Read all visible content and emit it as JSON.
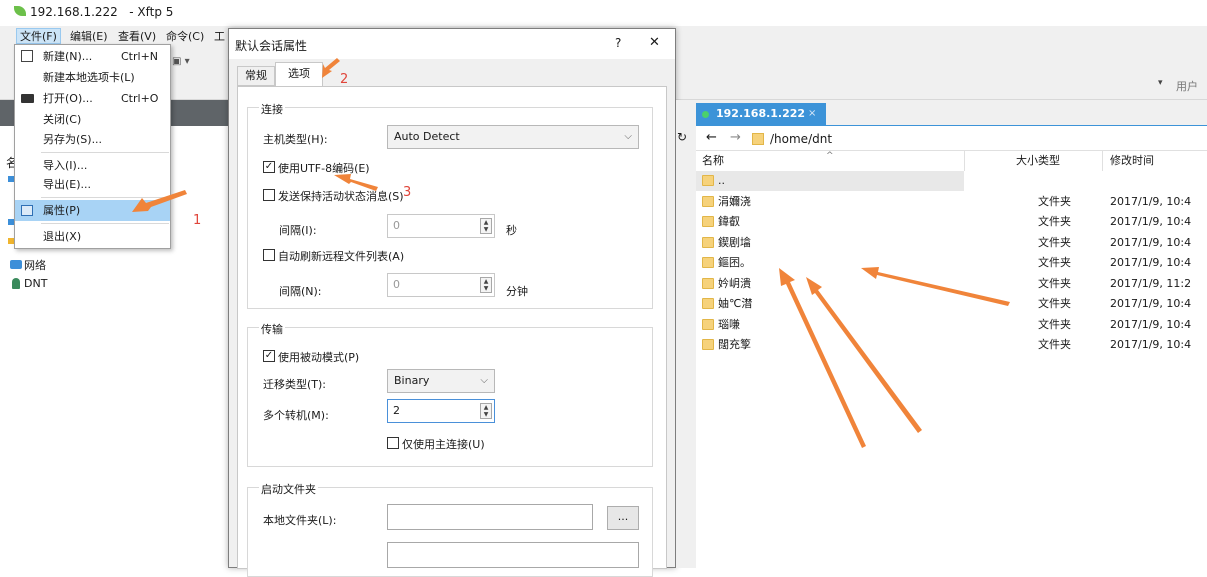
{
  "window": {
    "title": "192.168.1.222   - Xftp 5"
  },
  "menubar": {
    "items": [
      "文件(F)",
      "编辑(E)",
      "查看(V)",
      "命令(C)",
      "工"
    ]
  },
  "file_menu": {
    "items": [
      {
        "label": "新建(N)...",
        "shortcut": "Ctrl+N",
        "icon": "new-session-icon"
      },
      {
        "label": "新建本地选项卡(L)",
        "shortcut": ""
      },
      {
        "label": "打开(O)...",
        "shortcut": "Ctrl+O",
        "icon": "open-folder-icon"
      },
      {
        "label": "关闭(C)",
        "shortcut": ""
      },
      {
        "label": "另存为(S)...",
        "shortcut": ""
      },
      {
        "label": "导入(I)...",
        "shortcut": ""
      },
      {
        "label": "导出(E)...",
        "shortcut": ""
      },
      {
        "label": "属性(P)",
        "shortcut": "",
        "icon": "properties-icon",
        "highlighted": true
      },
      {
        "label": "退出(X)",
        "shortcut": ""
      }
    ]
  },
  "left_pane": {
    "items": [
      "网络",
      "DNT"
    ],
    "header_partial": "名"
  },
  "dialog": {
    "title": "默认会话属性",
    "help": "?",
    "close": "✕",
    "tabs": [
      "常规",
      "选项"
    ],
    "active_tab": "选项",
    "sections": {
      "connection": {
        "title": "连接",
        "host_type_label": "主机类型(H):",
        "host_type_value": "Auto Detect",
        "utf8_label": "使用UTF-8编码(E)",
        "utf8_checked": true,
        "keepalive_label": "发送保持活动状态消息(S)",
        "keepalive_checked": false,
        "interval_label": "间隔(I):",
        "interval_value": "0",
        "interval_unit": "秒",
        "autorefresh_label": "自动刷新远程文件列表(A)",
        "autorefresh_checked": false,
        "interval2_label": "间隔(N):",
        "interval2_value": "0",
        "interval2_unit": "分钟"
      },
      "transfer": {
        "title": "传输",
        "passive_label": "使用被动模式(P)",
        "passive_checked": true,
        "transfer_type_label": "迁移类型(T):",
        "transfer_type_value": "Binary",
        "multi_label": "多个转机(M):",
        "multi_value": "2",
        "primary_only_label": "仅使用主连接(U)",
        "primary_only_checked": false
      },
      "startup": {
        "title": "启动文件夹",
        "local_label": "本地文件夹(L):",
        "local_value": "",
        "browse_label": "..."
      }
    }
  },
  "remote": {
    "tab_label": "192.168.1.222",
    "tab_close": "×",
    "path": "/home/dnt",
    "user_label": "用户",
    "columns": [
      "名称",
      "大小",
      "类型",
      "修改时间"
    ],
    "files": [
      {
        "name": "..",
        "type": "",
        "modified": ""
      },
      {
        "name": "涓嬭浇",
        "type": "文件夹",
        "modified": "2017/1/9, 10:4"
      },
      {
        "name": "鍏叡",
        "type": "文件夹",
        "modified": "2017/1/9, 10:4"
      },
      {
        "name": "鍥剧墖",
        "type": "文件夹",
        "modified": "2017/1/9, 10:4"
      },
      {
        "name": "鏂囨。",
        "type": "文件夹",
        "modified": "2017/1/9, 10:4"
      },
      {
        "name": "妗岄潰",
        "type": "文件夹",
        "modified": "2017/1/9, 11:2"
      },
      {
        "name": "妯℃澘",
        "type": "文件夹",
        "modified": "2017/1/9, 10:4"
      },
      {
        "name": "瑙嗛",
        "type": "文件夹",
        "modified": "2017/1/9, 10:4"
      },
      {
        "name": "闊充箰",
        "type": "文件夹",
        "modified": "2017/1/9, 10:4"
      }
    ]
  },
  "annotations": [
    "1",
    "2",
    "3"
  ],
  "colors": {
    "arrow": "#f0843a",
    "highlight": "#a8d3f5",
    "annotation_text": "#e0453a"
  }
}
